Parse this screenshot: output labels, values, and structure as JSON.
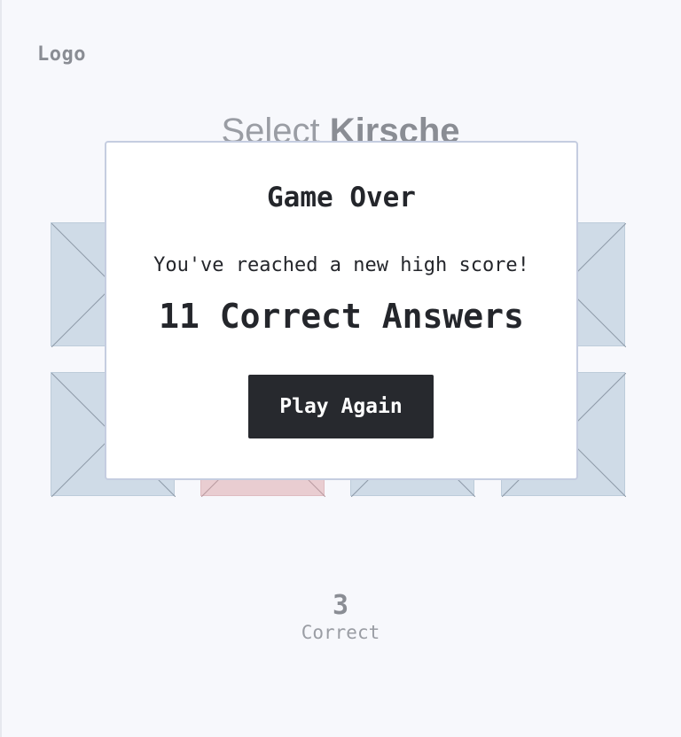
{
  "header": {
    "logo": "Logo"
  },
  "prompt": {
    "prefix": "Select",
    "target": "Kirsche"
  },
  "tiles": [
    {
      "state": "neutral"
    },
    {
      "state": "neutral"
    },
    {
      "state": "neutral"
    },
    {
      "state": "neutral"
    },
    {
      "state": "neutral"
    },
    {
      "state": "wrong"
    },
    {
      "state": "neutral"
    },
    {
      "state": "neutral"
    }
  ],
  "score": {
    "value": "3",
    "label": "Correct"
  },
  "modal": {
    "title": "Game Over",
    "message": "You've reached a new high score!",
    "result": "11 Correct Answers",
    "button_label": "Play Again"
  },
  "colors": {
    "background": "#f7f8fc",
    "tile": "#cfdbe7",
    "tile_wrong": "#e9cdd1",
    "button": "#27292e",
    "text_dark": "#24262b",
    "text_muted": "#8a8d94"
  }
}
